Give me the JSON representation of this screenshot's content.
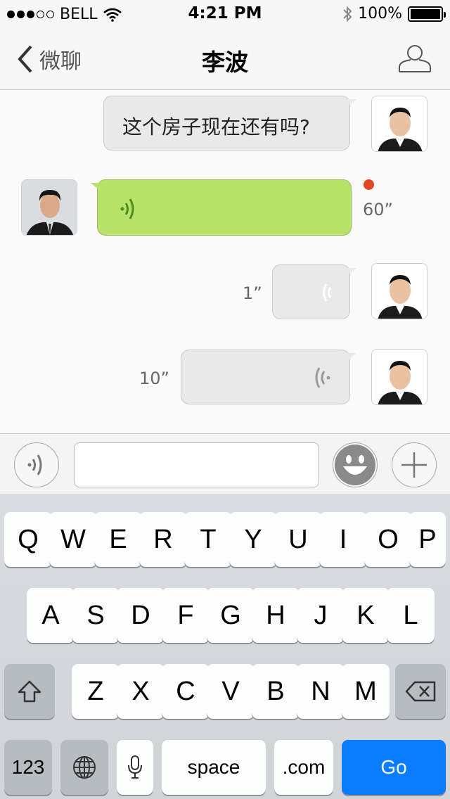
{
  "status_bar": {
    "carrier": "BELL",
    "time": "4:21 PM",
    "battery": "100%"
  },
  "nav": {
    "back_label": "微聊",
    "title": "李波"
  },
  "messages": [
    {
      "side": "right",
      "type": "text",
      "text": "这个房子现在还有吗?"
    },
    {
      "side": "left",
      "type": "voice",
      "duration": "60”",
      "unread": true
    },
    {
      "side": "right",
      "type": "voice",
      "duration": "1”"
    },
    {
      "side": "right",
      "type": "voice",
      "duration": "10”"
    }
  ],
  "input": {
    "value": "",
    "placeholder": ""
  },
  "keyboard": {
    "row1": [
      "Q",
      "W",
      "E",
      "R",
      "T",
      "Y",
      "U",
      "I",
      "O",
      "P"
    ],
    "row2": [
      "A",
      "S",
      "D",
      "F",
      "G",
      "H",
      "J",
      "K",
      "L"
    ],
    "row3": [
      "Z",
      "X",
      "C",
      "V",
      "B",
      "N",
      "M"
    ],
    "numbers_label": "123",
    "space_label": "space",
    "dotcom_label": ".com",
    "go_label": "Go"
  },
  "colors": {
    "accent": "#0a7cff",
    "voice_bubble_green": "#b7e36a",
    "unread_dot": "#e2461f"
  }
}
